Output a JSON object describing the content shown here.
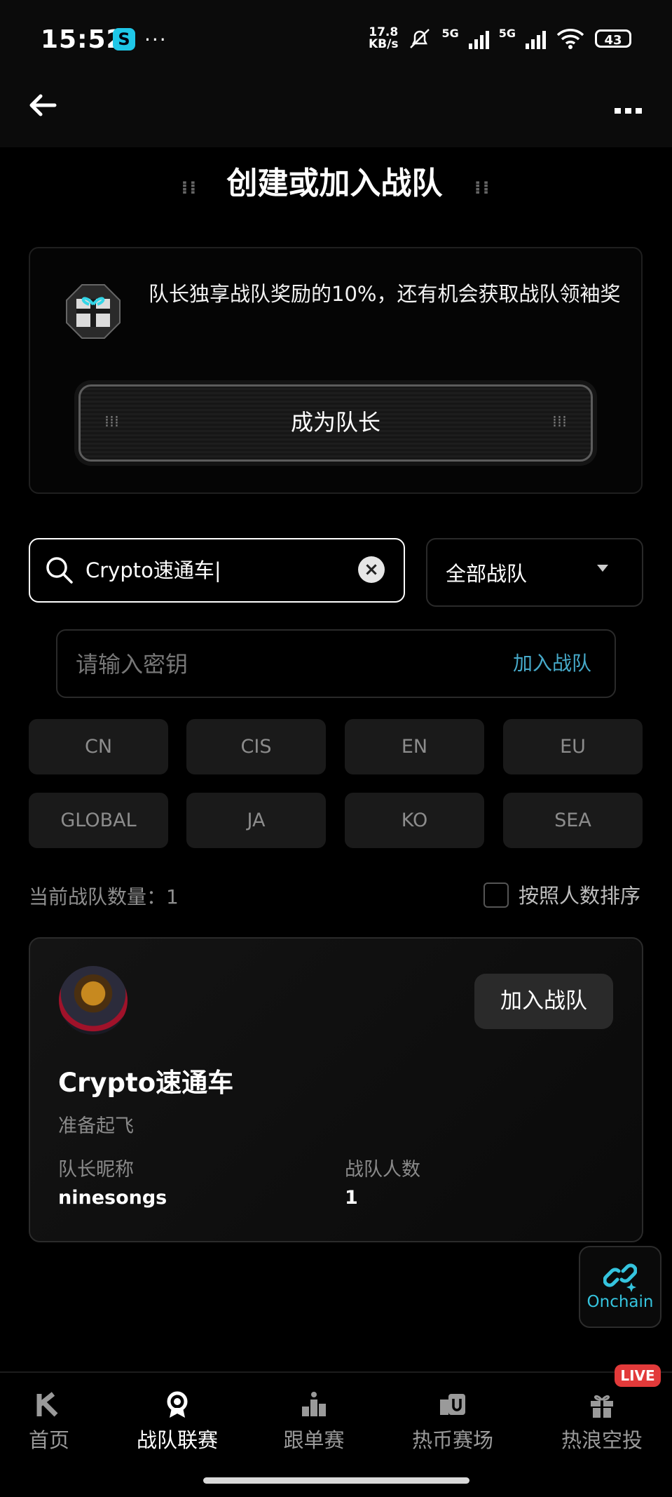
{
  "status_bar": {
    "time": "15:52",
    "net_speed_value": "17.8",
    "net_speed_unit": "KB/s",
    "network_1": "5G",
    "network_2": "5G",
    "battery": "43"
  },
  "header": {
    "title": "创建或加入战队"
  },
  "captain_card": {
    "text": "队长独享战队奖励的10%，还有机会获取战队领袖奖",
    "button_label": "成为队长"
  },
  "search": {
    "value": "Crypto速通车|"
  },
  "filter": {
    "selected": "全部战队"
  },
  "key_input": {
    "placeholder": "请输入密钥",
    "join_label": "加入战队"
  },
  "regions": [
    "CN",
    "CIS",
    "EN",
    "EU",
    "GLOBAL",
    "JA",
    "KO",
    "SEA"
  ],
  "list_meta": {
    "count_label": "当前战队数量：1",
    "sort_label": "按照人数排序"
  },
  "team": {
    "name": "Crypto速通车",
    "motto": "准备起飞",
    "captain_label": "队长昵称",
    "captain_value": "ninesongs",
    "members_label": "战队人数",
    "members_value": "1",
    "join_label": "加入战队"
  },
  "floating": {
    "onchain_label": "Onchain"
  },
  "bottom_nav": {
    "live_badge": "LIVE",
    "tabs": [
      {
        "label": "首页",
        "icon": "kucoin-logo-icon"
      },
      {
        "label": "战队联赛",
        "icon": "medal-icon"
      },
      {
        "label": "跟单赛",
        "icon": "podium-icon"
      },
      {
        "label": "热币赛场",
        "icon": "coin-arena-icon"
      },
      {
        "label": "热浪空投",
        "icon": "gift-icon"
      }
    ]
  },
  "colors": {
    "accent": "#46a9c9",
    "onchain": "#35c4de",
    "live": "#e23a3a",
    "background": "#000000"
  }
}
